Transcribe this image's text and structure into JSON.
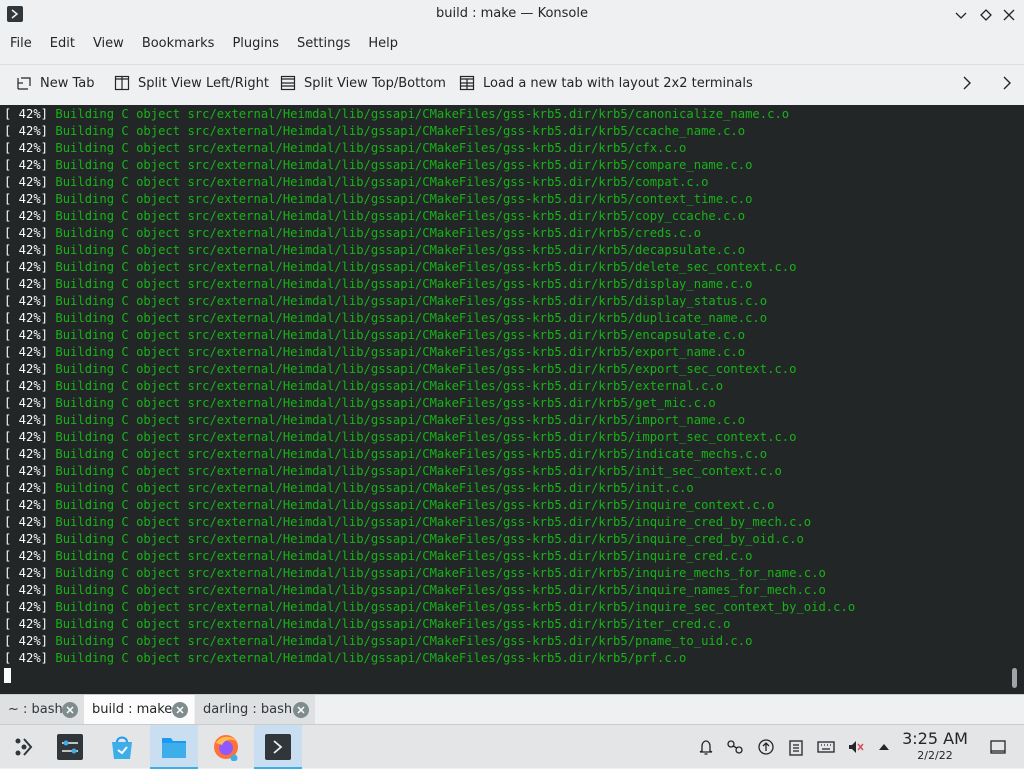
{
  "window": {
    "title": "build : make — Konsole"
  },
  "menu": [
    "File",
    "Edit",
    "View",
    "Bookmarks",
    "Plugins",
    "Settings",
    "Help"
  ],
  "toolbar": {
    "new_tab": "New Tab",
    "split_lr": "Split View Left/Right",
    "split_tb": "Split View Top/Bottom",
    "load_layout": "Load a new tab with layout 2x2 terminals"
  },
  "terminal": {
    "lines": [
      {
        "pct": "[ 42%] ",
        "msg": "Building C object src/external/Heimdal/lib/gssapi/CMakeFiles/gss-krb5.dir/krb5/canonicalize_name.c.o"
      },
      {
        "pct": "[ 42%] ",
        "msg": "Building C object src/external/Heimdal/lib/gssapi/CMakeFiles/gss-krb5.dir/krb5/ccache_name.c.o"
      },
      {
        "pct": "[ 42%] ",
        "msg": "Building C object src/external/Heimdal/lib/gssapi/CMakeFiles/gss-krb5.dir/krb5/cfx.c.o"
      },
      {
        "pct": "[ 42%] ",
        "msg": "Building C object src/external/Heimdal/lib/gssapi/CMakeFiles/gss-krb5.dir/krb5/compare_name.c.o"
      },
      {
        "pct": "[ 42%] ",
        "msg": "Building C object src/external/Heimdal/lib/gssapi/CMakeFiles/gss-krb5.dir/krb5/compat.c.o"
      },
      {
        "pct": "[ 42%] ",
        "msg": "Building C object src/external/Heimdal/lib/gssapi/CMakeFiles/gss-krb5.dir/krb5/context_time.c.o"
      },
      {
        "pct": "[ 42%] ",
        "msg": "Building C object src/external/Heimdal/lib/gssapi/CMakeFiles/gss-krb5.dir/krb5/copy_ccache.c.o"
      },
      {
        "pct": "[ 42%] ",
        "msg": "Building C object src/external/Heimdal/lib/gssapi/CMakeFiles/gss-krb5.dir/krb5/creds.c.o"
      },
      {
        "pct": "[ 42%] ",
        "msg": "Building C object src/external/Heimdal/lib/gssapi/CMakeFiles/gss-krb5.dir/krb5/decapsulate.c.o"
      },
      {
        "pct": "[ 42%] ",
        "msg": "Building C object src/external/Heimdal/lib/gssapi/CMakeFiles/gss-krb5.dir/krb5/delete_sec_context.c.o"
      },
      {
        "pct": "[ 42%] ",
        "msg": "Building C object src/external/Heimdal/lib/gssapi/CMakeFiles/gss-krb5.dir/krb5/display_name.c.o"
      },
      {
        "pct": "[ 42%] ",
        "msg": "Building C object src/external/Heimdal/lib/gssapi/CMakeFiles/gss-krb5.dir/krb5/display_status.c.o"
      },
      {
        "pct": "[ 42%] ",
        "msg": "Building C object src/external/Heimdal/lib/gssapi/CMakeFiles/gss-krb5.dir/krb5/duplicate_name.c.o"
      },
      {
        "pct": "[ 42%] ",
        "msg": "Building C object src/external/Heimdal/lib/gssapi/CMakeFiles/gss-krb5.dir/krb5/encapsulate.c.o"
      },
      {
        "pct": "[ 42%] ",
        "msg": "Building C object src/external/Heimdal/lib/gssapi/CMakeFiles/gss-krb5.dir/krb5/export_name.c.o"
      },
      {
        "pct": "[ 42%] ",
        "msg": "Building C object src/external/Heimdal/lib/gssapi/CMakeFiles/gss-krb5.dir/krb5/export_sec_context.c.o"
      },
      {
        "pct": "[ 42%] ",
        "msg": "Building C object src/external/Heimdal/lib/gssapi/CMakeFiles/gss-krb5.dir/krb5/external.c.o"
      },
      {
        "pct": "[ 42%] ",
        "msg": "Building C object src/external/Heimdal/lib/gssapi/CMakeFiles/gss-krb5.dir/krb5/get_mic.c.o"
      },
      {
        "pct": "[ 42%] ",
        "msg": "Building C object src/external/Heimdal/lib/gssapi/CMakeFiles/gss-krb5.dir/krb5/import_name.c.o"
      },
      {
        "pct": "[ 42%] ",
        "msg": "Building C object src/external/Heimdal/lib/gssapi/CMakeFiles/gss-krb5.dir/krb5/import_sec_context.c.o"
      },
      {
        "pct": "[ 42%] ",
        "msg": "Building C object src/external/Heimdal/lib/gssapi/CMakeFiles/gss-krb5.dir/krb5/indicate_mechs.c.o"
      },
      {
        "pct": "[ 42%] ",
        "msg": "Building C object src/external/Heimdal/lib/gssapi/CMakeFiles/gss-krb5.dir/krb5/init_sec_context.c.o"
      },
      {
        "pct": "[ 42%] ",
        "msg": "Building C object src/external/Heimdal/lib/gssapi/CMakeFiles/gss-krb5.dir/krb5/init.c.o"
      },
      {
        "pct": "[ 42%] ",
        "msg": "Building C object src/external/Heimdal/lib/gssapi/CMakeFiles/gss-krb5.dir/krb5/inquire_context.c.o"
      },
      {
        "pct": "[ 42%] ",
        "msg": "Building C object src/external/Heimdal/lib/gssapi/CMakeFiles/gss-krb5.dir/krb5/inquire_cred_by_mech.c.o"
      },
      {
        "pct": "[ 42%] ",
        "msg": "Building C object src/external/Heimdal/lib/gssapi/CMakeFiles/gss-krb5.dir/krb5/inquire_cred_by_oid.c.o"
      },
      {
        "pct": "[ 42%] ",
        "msg": "Building C object src/external/Heimdal/lib/gssapi/CMakeFiles/gss-krb5.dir/krb5/inquire_cred.c.o"
      },
      {
        "pct": "[ 42%] ",
        "msg": "Building C object src/external/Heimdal/lib/gssapi/CMakeFiles/gss-krb5.dir/krb5/inquire_mechs_for_name.c.o"
      },
      {
        "pct": "[ 42%] ",
        "msg": "Building C object src/external/Heimdal/lib/gssapi/CMakeFiles/gss-krb5.dir/krb5/inquire_names_for_mech.c.o"
      },
      {
        "pct": "[ 42%] ",
        "msg": "Building C object src/external/Heimdal/lib/gssapi/CMakeFiles/gss-krb5.dir/krb5/inquire_sec_context_by_oid.c.o"
      },
      {
        "pct": "[ 42%] ",
        "msg": "Building C object src/external/Heimdal/lib/gssapi/CMakeFiles/gss-krb5.dir/krb5/iter_cred.c.o"
      },
      {
        "pct": "[ 42%] ",
        "msg": "Building C object src/external/Heimdal/lib/gssapi/CMakeFiles/gss-krb5.dir/krb5/pname_to_uid.c.o"
      },
      {
        "pct": "[ 42%] ",
        "msg": "Building C object src/external/Heimdal/lib/gssapi/CMakeFiles/gss-krb5.dir/krb5/prf.c.o"
      }
    ]
  },
  "tabs": [
    {
      "label": "~ : bash",
      "active": false
    },
    {
      "label": "build : make",
      "active": true
    },
    {
      "label": "darling : bash",
      "active": false
    }
  ],
  "taskbar": {
    "apps": [
      "application-launcher-icon",
      "system-settings-icon",
      "discover-store-icon",
      "file-manager-icon",
      "firefox-icon",
      "konsole-icon"
    ],
    "tray": [
      "notifications-icon",
      "kde-connect-icon",
      "updates-icon",
      "clipboard-icon",
      "keyboard-icon",
      "volume-muted-icon",
      "tray-expand-icon",
      "show-desktop-icon"
    ],
    "clock_time": "3:25 AM",
    "clock_date": "2/2/22"
  },
  "colors": {
    "terminal_bg": "#232627",
    "terminal_text_green": "#18b218",
    "terminal_text_white": "#fcfcfc",
    "accent": "#3daee9"
  }
}
